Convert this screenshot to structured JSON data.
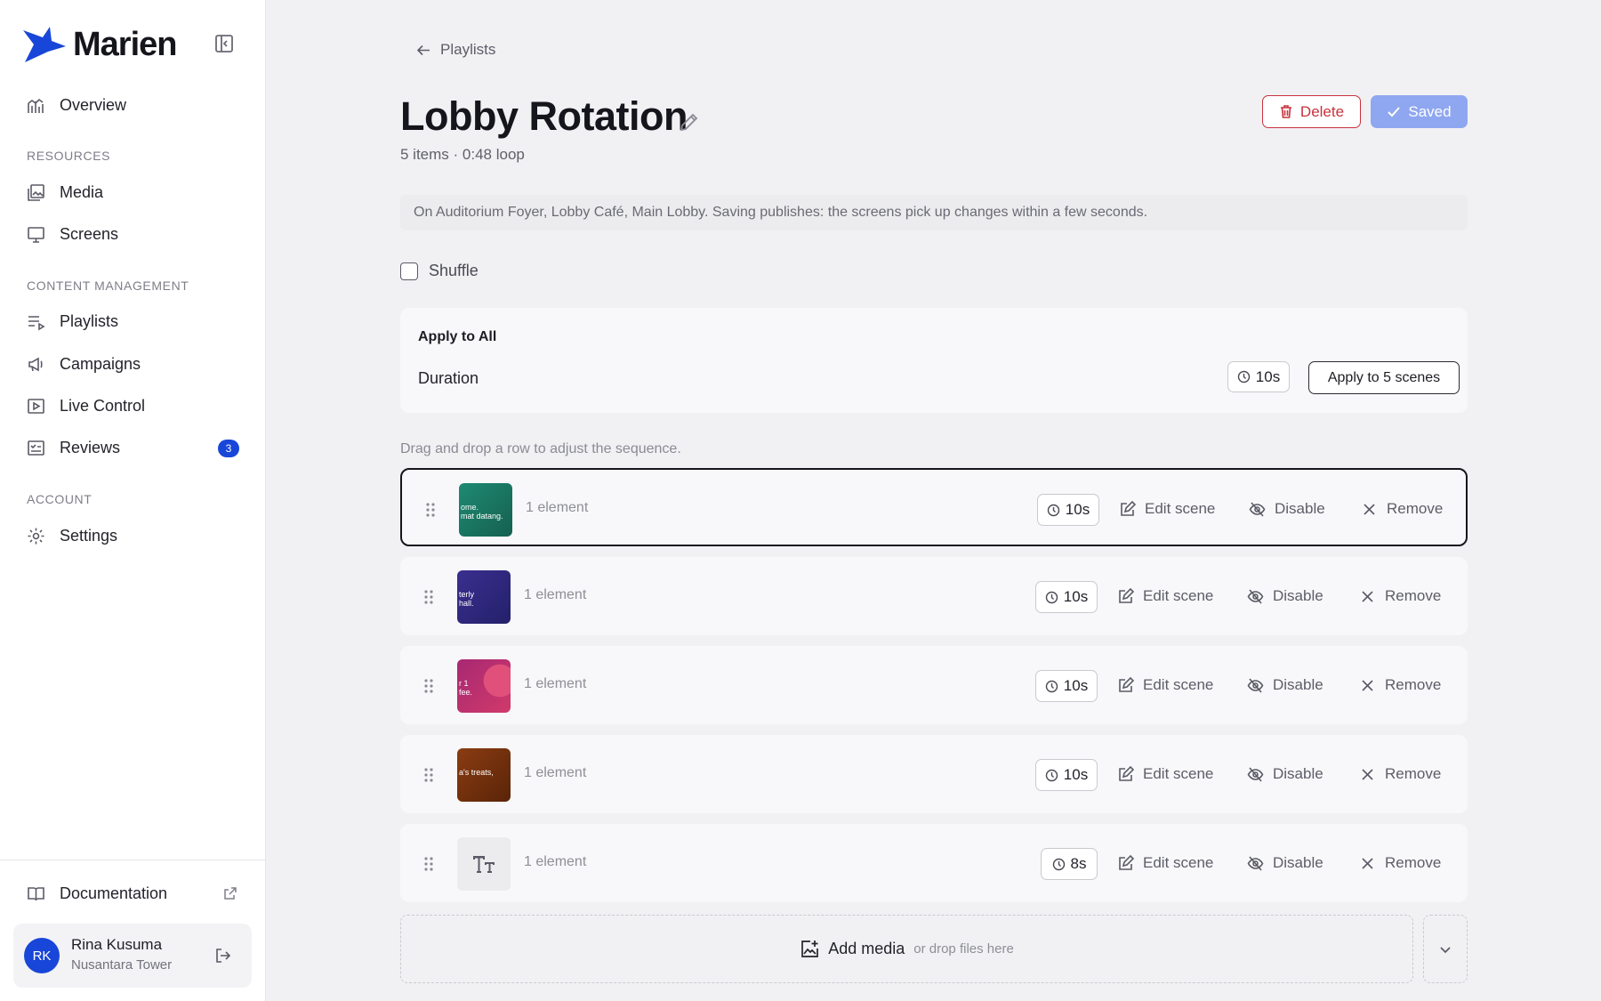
{
  "brand": {
    "name": "Marien",
    "accent": "#1846d8"
  },
  "sidebar": {
    "items": [
      {
        "label": "Overview",
        "icon": "chart-icon"
      },
      {
        "label": "Media",
        "icon": "images-icon"
      },
      {
        "label": "Screens",
        "icon": "monitor-icon"
      },
      {
        "label": "Playlists",
        "icon": "playlist-icon"
      },
      {
        "label": "Campaigns",
        "icon": "megaphone-icon"
      },
      {
        "label": "Live Control",
        "icon": "play-icon"
      },
      {
        "label": "Reviews",
        "icon": "review-icon",
        "badge": "3"
      },
      {
        "label": "Settings",
        "icon": "gear-icon"
      }
    ],
    "sections": {
      "resources": "RESOURCES",
      "content": "CONTENT MANAGEMENT",
      "account": "ACCOUNT"
    },
    "documentation": "Documentation",
    "user": {
      "initials": "RK",
      "name": "Rina Kusuma",
      "org": "Nusantara Tower"
    }
  },
  "header": {
    "breadcrumb": "Playlists",
    "title": "Lobby Rotation",
    "subtitle": "5 items · 0:48 loop",
    "delete_label": "Delete",
    "saved_label": "Saved"
  },
  "info": "On Auditorium Foyer, Lobby Café, Main Lobby. Saving publishes: the screens pick up changes within a few seconds.",
  "shuffle": {
    "label": "Shuffle",
    "checked": false
  },
  "apply_all": {
    "title": "Apply to All",
    "duration_label": "Duration",
    "duration_value": "10s",
    "apply_button": "Apply to 5 scenes"
  },
  "hint": "Drag and drop a row to adjust the sequence.",
  "actions": {
    "edit": "Edit scene",
    "disable": "Disable",
    "remove": "Remove"
  },
  "scenes": [
    {
      "label": "1 element",
      "duration": "10s",
      "thumb_text": "ome.\nmat datang.",
      "thumb_color": "#1e8a72"
    },
    {
      "label": "1 element",
      "duration": "10s",
      "thumb_text": "terly\nhall.",
      "thumb_color": "#3a2f8f"
    },
    {
      "label": "1 element",
      "duration": "10s",
      "thumb_text": "r 1\nfee.",
      "thumb_color": "#c2327c"
    },
    {
      "label": "1 element",
      "duration": "10s",
      "thumb_text": "a's treats,",
      "thumb_color": "#8a3c12"
    },
    {
      "label": "1 element",
      "duration": "8s",
      "thumb_text": "",
      "thumb_color": "#ececef",
      "thumb_icon": "text-icon"
    }
  ],
  "add_media": {
    "label": "Add media",
    "hint": "or drop files here"
  }
}
